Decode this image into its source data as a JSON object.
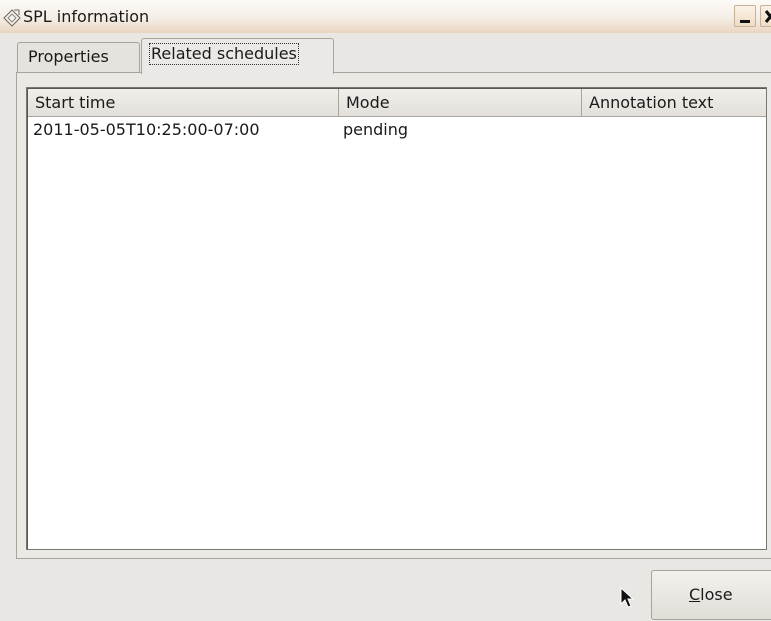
{
  "window": {
    "title": "SPL information",
    "icon": "diamond-app-icon",
    "buttons": [
      "minimize-icon",
      "close-icon"
    ]
  },
  "tabs": [
    {
      "label": "Properties",
      "active": false
    },
    {
      "label": "Related schedules",
      "active": true
    }
  ],
  "table": {
    "columns": [
      "Start time",
      "Mode",
      "Annotation text"
    ],
    "rows": [
      {
        "start_time": "2011-05-05T10:25:00-07:00",
        "mode": "pending",
        "annotation": ""
      }
    ]
  },
  "footer": {
    "close_label": "Close"
  }
}
